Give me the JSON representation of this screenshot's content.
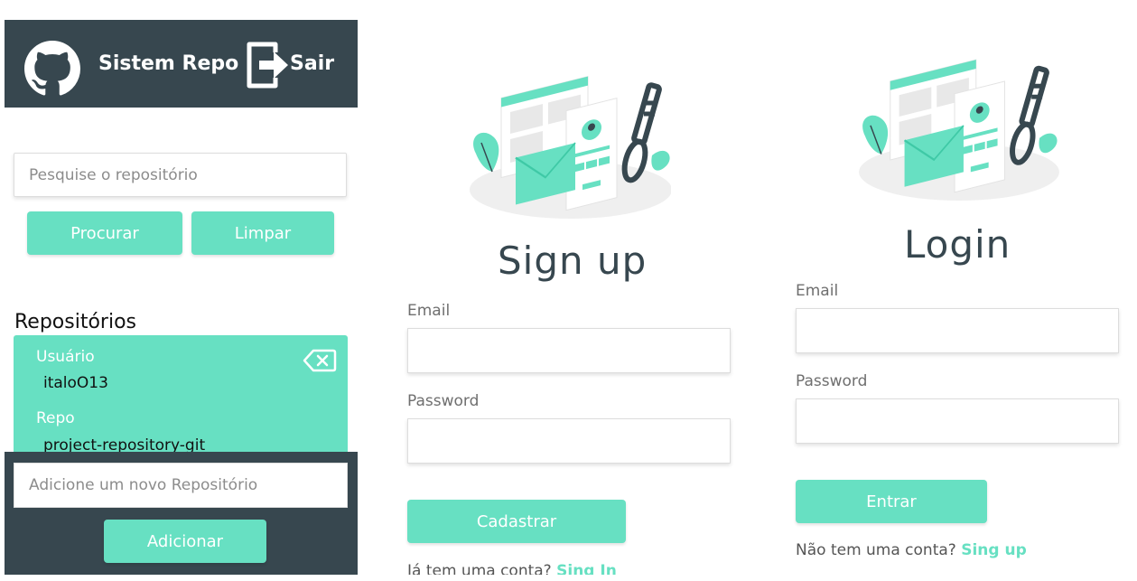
{
  "header": {
    "brand_title": "Sistem Repo",
    "logout_label": "Sair"
  },
  "search": {
    "placeholder": "Pesquise o repositório",
    "search_button": "Procurar",
    "clear_button": "Limpar"
  },
  "repositories": {
    "heading": "Repositórios",
    "items": [
      {
        "user_label": "Usuário",
        "user_value": "italoO13",
        "repo_label": "Repo",
        "repo_value": "project-repository-git"
      }
    ]
  },
  "add_repo": {
    "placeholder": "Adicione um novo Repositório",
    "button": "Adicionar"
  },
  "signup": {
    "title": "Sign up",
    "email_label": "Email",
    "password_label": "Password",
    "submit_button": "Cadastrar",
    "footer_text": "Já tem uma conta?",
    "footer_link": "Sing In"
  },
  "login": {
    "title": "Login",
    "email_label": "Email",
    "password_label": "Password",
    "submit_button": "Entrar",
    "footer_text": "Não tem uma conta?",
    "footer_link": "Sing up"
  },
  "colors": {
    "accent": "#67e0c2",
    "dark": "#37474f"
  },
  "icons": [
    "github-icon",
    "logout-icon",
    "delete-icon",
    "login-illustration"
  ]
}
